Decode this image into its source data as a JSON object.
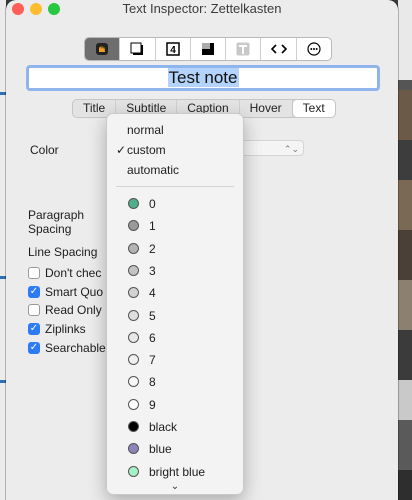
{
  "window": {
    "title": "Text Inspector: Zettelkasten"
  },
  "toolbar": {
    "buttons": [
      {
        "icon": "hand-icon",
        "selected": true
      },
      {
        "icon": "square-shadow-icon"
      },
      {
        "icon": "four-box-icon",
        "glyph": "4"
      },
      {
        "icon": "gradient-square-icon"
      },
      {
        "icon": "text-T-icon",
        "glyph": "T"
      },
      {
        "icon": "code-brackets-icon",
        "glyph": "<>"
      },
      {
        "icon": "ellipsis-circle-icon"
      }
    ]
  },
  "note": {
    "title": "Test note"
  },
  "tabs": [
    "Title",
    "Subtitle",
    "Caption",
    "Hover",
    "Text"
  ],
  "labels": {
    "color": "Color",
    "paragraph_spacing": "Paragraph Spacing",
    "line_spacing": "Line Spacing"
  },
  "checkboxes": [
    {
      "label": "Don't chec",
      "checked": false
    },
    {
      "label": "Smart Quo",
      "checked": true
    },
    {
      "label": "Read Only",
      "checked": false
    },
    {
      "label": "Ziplinks",
      "checked": true
    },
    {
      "label": "Searchable",
      "checked": true
    }
  ],
  "menu": {
    "options": [
      {
        "label": "normal",
        "checked": false
      },
      {
        "label": "custom",
        "checked": true
      },
      {
        "label": "automatic",
        "checked": false
      }
    ],
    "check_mark": "✓",
    "swatches": [
      {
        "label": "0",
        "color": "#4fae8c"
      },
      {
        "label": "1",
        "color": "#9a9a9a"
      },
      {
        "label": "2",
        "color": "#b3b3b3"
      },
      {
        "label": "3",
        "color": "#c4c4c4"
      },
      {
        "label": "4",
        "color": "#d2d2d2"
      },
      {
        "label": "5",
        "color": "#dedede"
      },
      {
        "label": "6",
        "color": "#e8e8e8"
      },
      {
        "label": "7",
        "color": "#f0f0f0"
      },
      {
        "label": "8",
        "color": "#f7f7f7"
      },
      {
        "label": "9",
        "color": "#ffffff"
      },
      {
        "label": "black",
        "color": "#000000"
      },
      {
        "label": "blue",
        "color": "#8b85b8"
      },
      {
        "label": "bright blue",
        "color": "#a8f0c8"
      }
    ]
  }
}
